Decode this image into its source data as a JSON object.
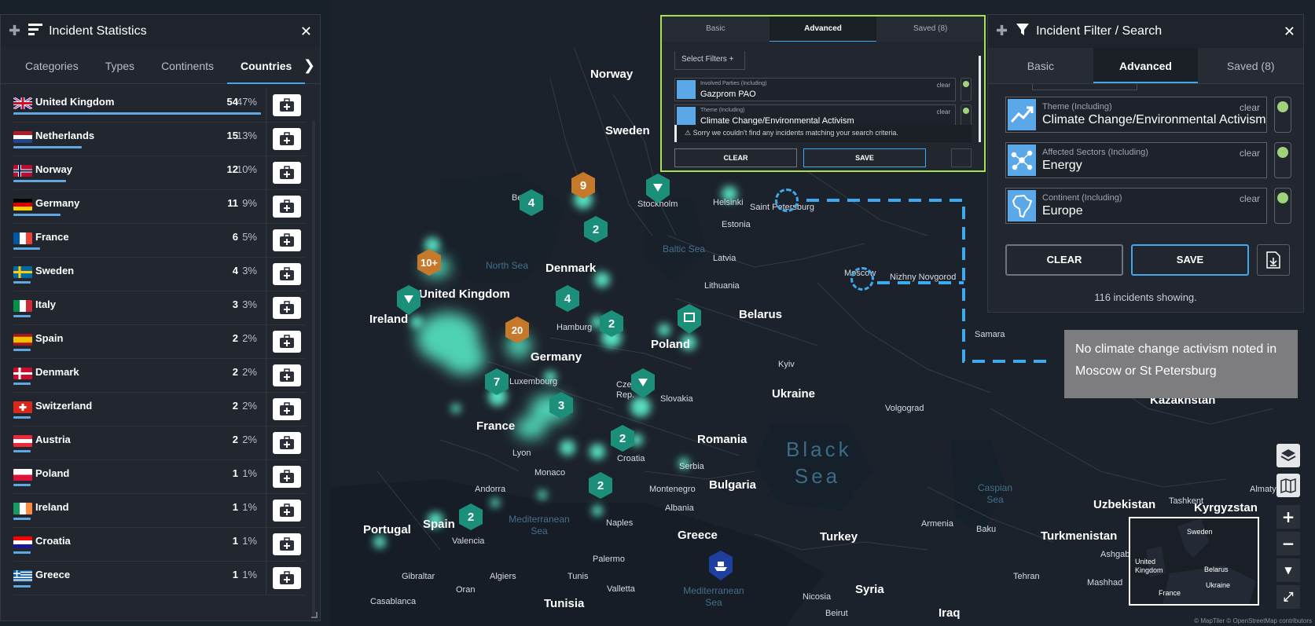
{
  "stats_panel": {
    "title": "Incident Statistics",
    "tabs": [
      {
        "label": "Categories",
        "active": false
      },
      {
        "label": "Types",
        "active": false
      },
      {
        "label": "Continents",
        "active": false
      },
      {
        "label": "Countries",
        "active": true
      }
    ],
    "countries": [
      {
        "name": "United Kingdom",
        "count": "54",
        "pct": "47%",
        "share": 0.47,
        "flag": "gb"
      },
      {
        "name": "Netherlands",
        "count": "15",
        "pct": "13%",
        "share": 0.13,
        "flag": "nl"
      },
      {
        "name": "Norway",
        "count": "12",
        "pct": "10%",
        "share": 0.1,
        "flag": "no"
      },
      {
        "name": "Germany",
        "count": "11",
        "pct": "9%",
        "share": 0.09,
        "flag": "de"
      },
      {
        "name": "France",
        "count": "6",
        "pct": "5%",
        "share": 0.05,
        "flag": "fr"
      },
      {
        "name": "Sweden",
        "count": "4",
        "pct": "3%",
        "share": 0.03,
        "flag": "se"
      },
      {
        "name": "Italy",
        "count": "3",
        "pct": "3%",
        "share": 0.03,
        "flag": "it"
      },
      {
        "name": "Spain",
        "count": "2",
        "pct": "2%",
        "share": 0.02,
        "flag": "es"
      },
      {
        "name": "Denmark",
        "count": "2",
        "pct": "2%",
        "share": 0.02,
        "flag": "dk"
      },
      {
        "name": "Switzerland",
        "count": "2",
        "pct": "2%",
        "share": 0.02,
        "flag": "ch"
      },
      {
        "name": "Austria",
        "count": "2",
        "pct": "2%",
        "share": 0.02,
        "flag": "at"
      },
      {
        "name": "Poland",
        "count": "1",
        "pct": "1%",
        "share": 0.01,
        "flag": "pl"
      },
      {
        "name": "Ireland",
        "count": "1",
        "pct": "1%",
        "share": 0.01,
        "flag": "ie"
      },
      {
        "name": "Croatia",
        "count": "1",
        "pct": "1%",
        "share": 0.01,
        "flag": "hr"
      },
      {
        "name": "Greece",
        "count": "1",
        "pct": "1%",
        "share": 0.01,
        "flag": "gr"
      }
    ]
  },
  "small_filter": {
    "tabs": [
      "Basic",
      "Advanced",
      "Saved (8)"
    ],
    "select_filters": "Select Filters  +",
    "fields": [
      {
        "label": "Involved Parties (Including)",
        "value": "Gazprom PAO",
        "clear": "clear"
      },
      {
        "label": "Theme (Including)",
        "value": "Climate Change/Environmental Activism",
        "clear": "clear"
      }
    ],
    "warning": "Sorry we couldn't find any incidents matching your search criteria.",
    "clear_label": "CLEAR",
    "save_label": "SAVE"
  },
  "filter_panel": {
    "title": "Incident Filter / Search",
    "tabs": [
      {
        "label": "Basic",
        "active": false
      },
      {
        "label": "Advanced",
        "active": true
      },
      {
        "label": "Saved (8)",
        "active": false
      }
    ],
    "fields": [
      {
        "label": "Theme (Including)",
        "value": "Climate Change/Environmental Activism",
        "clear": "clear",
        "icon": "trend-icon"
      },
      {
        "label": "Affected Sectors (Including)",
        "value": "Energy",
        "clear": "clear",
        "icon": "network-icon"
      },
      {
        "label": "Continent (Including)",
        "value": "Europe",
        "clear": "clear",
        "icon": "africa-icon"
      }
    ],
    "clear_label": "CLEAR",
    "save_label": "SAVE",
    "incidents_showing": "116 incidents showing."
  },
  "annotation": {
    "text": "No climate change activism noted in Moscow or St Petersburg"
  },
  "map": {
    "countries": [
      "Norway",
      "Sweden",
      "Denmark",
      "United Kingdom",
      "Ireland",
      "Germany",
      "Belarus",
      "Poland",
      "Ukraine",
      "France",
      "Romania",
      "Bulgaria",
      "Greece",
      "Turkey",
      "Portugal",
      "Spain",
      "Tunisia",
      "Syria",
      "Iraq",
      "Kazakhstan",
      "Uzbekistan",
      "Turkmenistan",
      "Kyrgyzstan",
      "Lithuania",
      "Latvia",
      "Estonia",
      "Slovakia",
      "Croatia",
      "Albania",
      "Montenegro",
      "Serbia",
      "Armenia"
    ],
    "cities": [
      "Saint Petersburg",
      "Moscow",
      "Nizhny Novgorod",
      "Samara",
      "Volgograd",
      "Kyiv",
      "Helsinki",
      "Stockholm",
      "Hamburg",
      "Luxembourg",
      "Lyon",
      "Monaco",
      "Andorra",
      "Valencia",
      "Gibraltar",
      "Algiers",
      "Casablanca",
      "Oran",
      "Tunis",
      "Valletta",
      "Palermo",
      "Naples",
      "Nicosia",
      "Beirut",
      "Baku",
      "Tehran",
      "Mashhad",
      "Tashkent",
      "Almaty",
      "Ashgabat",
      "Bergen",
      "Czech Rep."
    ],
    "seas": [
      "North Sea",
      "Baltic Sea",
      "Mediterranean Sea",
      "Black Sea",
      "Caspian Sea"
    ],
    "clusters": [
      "4",
      "9",
      "2",
      "10+",
      "4",
      "2",
      "20",
      "7",
      "3",
      "2",
      "2",
      "2"
    ],
    "minimap_labels": [
      "Sweden",
      "United Kingdom",
      "Belarus",
      "Ukraine",
      "France"
    ],
    "attribution": "© MapTiler © OpenStreetMap contributors"
  },
  "colors": {
    "accent": "#3fa9ee",
    "heat": "#58f0cc",
    "cluster": "#1b8f79",
    "cluster_orange": "#c7792b",
    "toggle_on": "#9fd27a",
    "highlight_border": "#a7e052"
  }
}
